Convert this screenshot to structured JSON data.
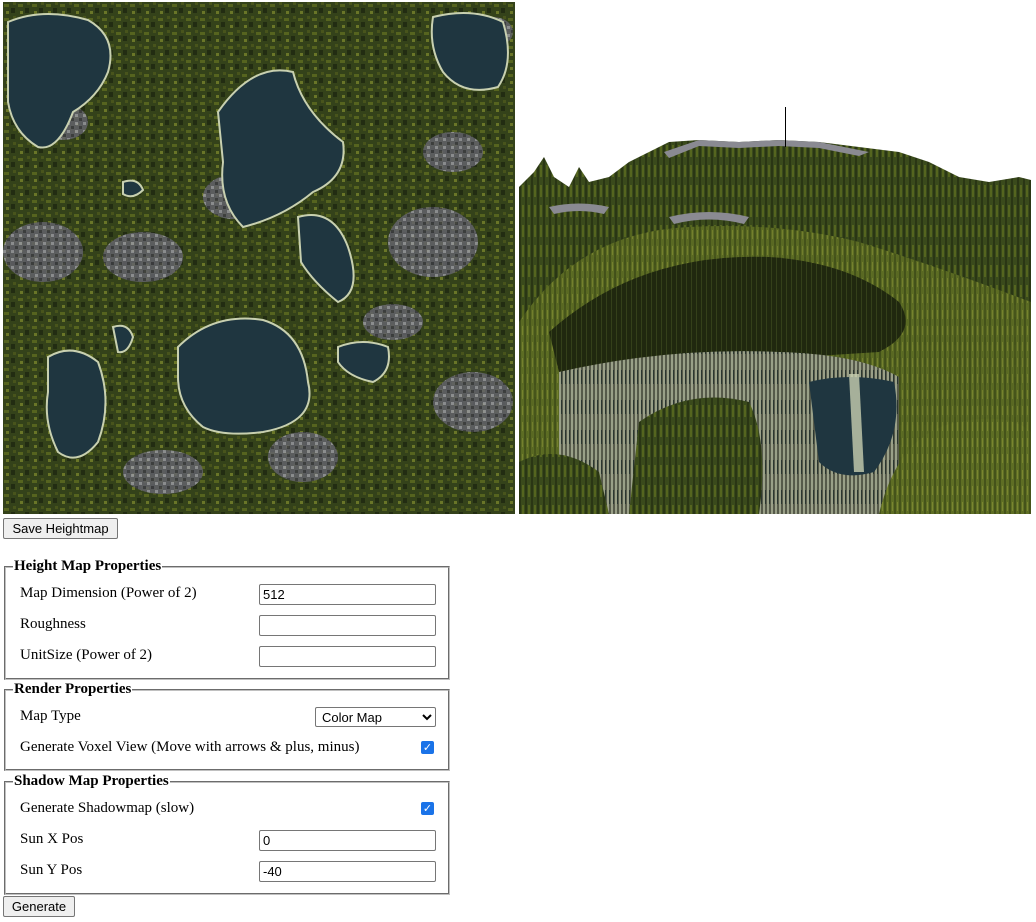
{
  "buttons": {
    "save_heightmap": "Save Heightmap",
    "generate": "Generate"
  },
  "height_map": {
    "legend": "Height Map Properties",
    "map_dimension_label": "Map Dimension (Power of 2)",
    "map_dimension_value": "512",
    "roughness_label": "Roughness",
    "roughness_value": "",
    "unit_size_label": "UnitSize (Power of 2)",
    "unit_size_value": ""
  },
  "render": {
    "legend": "Render Properties",
    "map_type_label": "Map Type",
    "map_type_selected": "Color Map",
    "voxel_label": "Generate Voxel View (Move with arrows & plus, minus)",
    "voxel_checked": true
  },
  "shadow": {
    "legend": "Shadow Map Properties",
    "shadowmap_label": "Generate Shadowmap (slow)",
    "shadowmap_checked": true,
    "sun_x_label": "Sun X Pos",
    "sun_x_value": "0",
    "sun_y_label": "Sun Y Pos",
    "sun_y_value": "-40"
  },
  "colors": {
    "grass_dark": "#2c3a18",
    "grass": "#4d5a1e",
    "grass_light": "#6e7a2a",
    "rock": "#7a7a82",
    "water": "#1f3640",
    "shore": "#c8d0b0",
    "checkbox": "#1a73e8"
  }
}
